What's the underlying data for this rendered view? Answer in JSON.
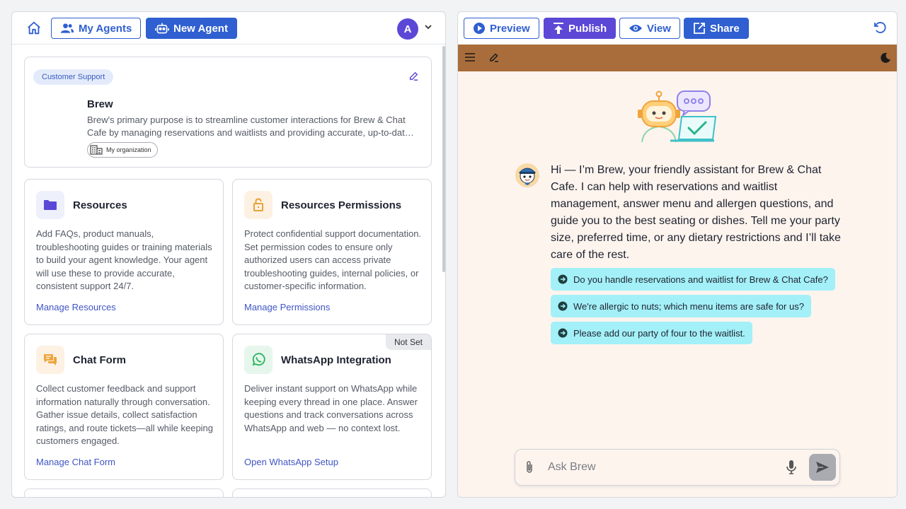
{
  "left_toolbar": {
    "my_agents_label": "My Agents",
    "new_agent_label": "New Agent",
    "avatar_letter": "A"
  },
  "agent": {
    "tag": "Customer Support",
    "name": "Brew",
    "description": "Brew's primary purpose is to streamline customer interactions for Brew & Chat Cafe by managing reservations and waitlists and providing accurate, up-to-date menu information.",
    "scope": "My organization"
  },
  "features": [
    {
      "title": "Resources",
      "description": "Add FAQs, product manuals, troubleshooting guides or training materials to build your agent knowledge. Your agent will use these to provide accurate, consistent support 24/7.",
      "link": "Manage Resources",
      "icon": "folder-icon"
    },
    {
      "title": "Resources Permissions",
      "description": "Protect confidential support documentation. Set permission codes to ensure only authorized users can access private troubleshooting guides, internal policies, or customer-specific information.",
      "link": "Manage Permissions",
      "icon": "lock-icon"
    },
    {
      "title": "Chat Form",
      "description": "Collect customer feedback and support information naturally through conversation. Gather issue details, collect satisfaction ratings, and route tickets—all while keeping customers engaged.",
      "link": "Manage Chat Form",
      "icon": "chat-icon"
    },
    {
      "title": "WhatsApp Integration",
      "description": "Deliver instant support on WhatsApp while keeping every thread in one place. Answer questions and track conversations across WhatsApp and web — no context lost.",
      "link": "Open WhatsApp Setup",
      "icon": "whatsapp-icon",
      "badge": "Not Set"
    }
  ],
  "right_toolbar": {
    "preview_label": "Preview",
    "publish_label": "Publish",
    "view_label": "View",
    "share_label": "Share"
  },
  "chat": {
    "greeting": "Hi — I’m Brew, your friendly assistant for Brew & Chat Cafe. I can help with reservations and waitlist management, answer menu and allergen questions, and guide you to the best seating or dishes. Tell me your party size, preferred time, or any dietary restrictions and I’ll take care of the rest.",
    "suggestions": [
      "Do you handle reservations and waitlist for Brew & Chat Cafe?",
      "We're allergic to nuts; which menu items are safe for us?",
      "Please add our party of four to the waitlist."
    ],
    "input_placeholder": "Ask Brew"
  },
  "colors": {
    "primary_blue": "#2f5fd0",
    "purple": "#5b48d6",
    "header_brown": "#a86d3a",
    "chat_background": "#fdf4ee",
    "suggestion_cyan": "#a3f0f8"
  }
}
